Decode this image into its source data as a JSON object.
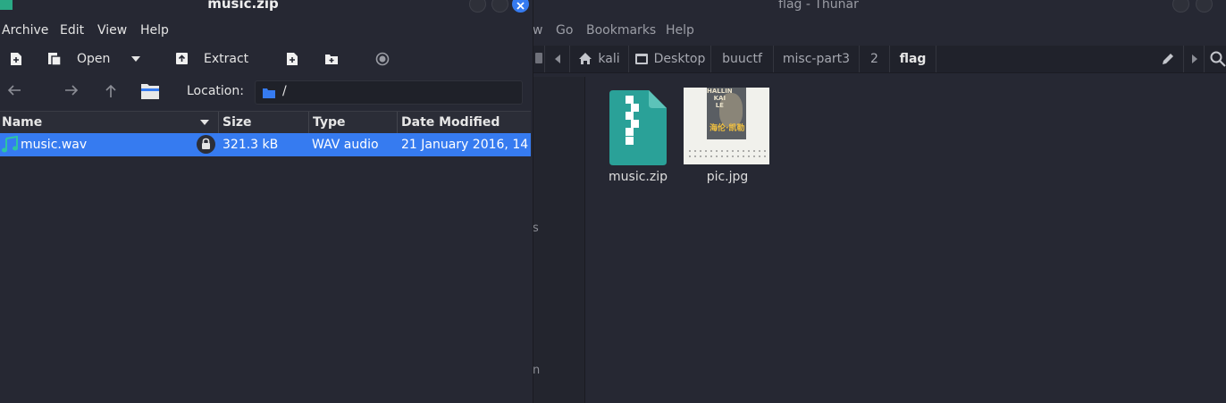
{
  "thunar": {
    "title": "flag - Thunar",
    "menu": [
      "w",
      "Go",
      "Bookmarks",
      "Help"
    ],
    "breadcrumbs": [
      "kali",
      "Desktop",
      "buuctf",
      "misc-part3",
      "2",
      "flag"
    ],
    "sidepane_fragments": [
      "s",
      "n"
    ],
    "files": [
      {
        "name": "music.zip",
        "icon": "archive-zip-icon"
      },
      {
        "name": "pic.jpg",
        "icon": "image-thumbnail"
      }
    ],
    "thumbnail_text": {
      "line1": "HALLIN",
      "line2": "KAI",
      "line3": "LE",
      "line4": "海伦·凯勒"
    }
  },
  "engrampa": {
    "title": "music.zip",
    "menu": [
      "Archive",
      "Edit",
      "View",
      "Help"
    ],
    "toolbar": {
      "open_label": "Open",
      "extract_label": "Extract"
    },
    "location": {
      "label": "Location:",
      "path": "/"
    },
    "columns": [
      "Name",
      "Size",
      "Type",
      "Date Modified"
    ],
    "rows": [
      {
        "name": "music.wav",
        "size": "321.3 kB",
        "type": "WAV audio",
        "date": "21 January 2016, 14…",
        "encrypted": true
      }
    ]
  },
  "colors": {
    "accent": "#367bf0",
    "zip_teal": "#2aa198",
    "close_button": "#367bf0"
  }
}
